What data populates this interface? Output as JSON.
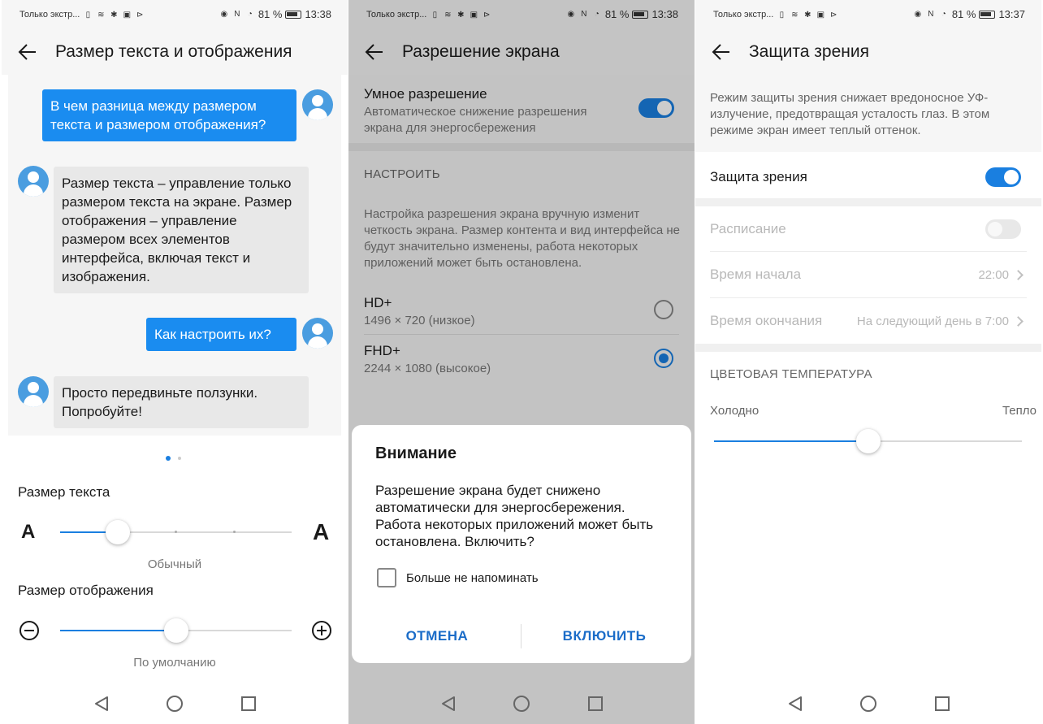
{
  "status_bar": {
    "carrier": "Только экстр...",
    "battery_text": "81 %",
    "times": [
      "13:38",
      "13:38",
      "13:37"
    ]
  },
  "screen1": {
    "title": "Размер текста и отображения",
    "chat": [
      {
        "from": "user",
        "text": "В чем разница между размером текста и размером отображения?"
      },
      {
        "from": "bot",
        "text": "Размер текста – управление только размером текста на экране. Размер отображения – управление размером всех элементов интерфейса, включая текст и изображения."
      },
      {
        "from": "user",
        "text": "Как настроить их?"
      },
      {
        "from": "bot",
        "text": "Просто передвиньте ползунки. Попробуйте!"
      }
    ],
    "text_size": {
      "label": "Размер текста",
      "value_label": "Обычный",
      "level_fraction": 0.25,
      "small_glyph": "A",
      "large_glyph": "A"
    },
    "display_size": {
      "label": "Размер отображения",
      "value_label": "По умолчанию",
      "level_fraction": 0.5
    }
  },
  "screen2": {
    "title": "Разрешение экрана",
    "smart": {
      "title": "Умное разрешение",
      "subtitle": "Автоматическое снижение разрешения экрана для энергосбережения",
      "on": true
    },
    "section_header": "НАСТРОИТЬ",
    "description": "Настройка разрешения экрана вручную изменит четкость экрана. Размер контента и вид интерфейса не будут значительно изменены, работа некоторых приложений может быть остановлена.",
    "options": [
      {
        "title": "HD+",
        "subtitle": "1496 × 720 (низкое)",
        "selected": false
      },
      {
        "title": "FHD+",
        "subtitle": "2244 × 1080 (высокое)",
        "selected": true
      }
    ],
    "dialog": {
      "title": "Внимание",
      "body": "Разрешение экрана будет снижено автоматически для энергосбережения. Работа некоторых приложений может быть остановлена. Включить?",
      "checkbox_label": "Больше не напоминать",
      "cancel": "ОТМЕНА",
      "confirm": "ВКЛЮЧИТЬ"
    }
  },
  "screen3": {
    "title": "Защита зрения",
    "intro": "Режим защиты зрения снижает вредоносное УФ-излучение, предотвращая усталость глаз. В этом режиме экран имеет теплый оттенок.",
    "eye_comfort": {
      "label": "Защита зрения",
      "on": true
    },
    "schedule": {
      "label": "Расписание",
      "on": false
    },
    "start_time": {
      "label": "Время начала",
      "value": "22:00"
    },
    "end_time": {
      "label": "Время окончания",
      "value": "На следующий день в 7:00"
    },
    "color_temp": {
      "header": "ЦВЕТОВАЯ ТЕМПЕРАТУРА",
      "left_label": "Холодно",
      "right_label": "Тепло",
      "level_fraction": 0.5
    }
  },
  "colors": {
    "accent": "#1a7fe0",
    "bubble_blue": "#1a8cf0",
    "dialog_button": "#1a6cc8"
  }
}
